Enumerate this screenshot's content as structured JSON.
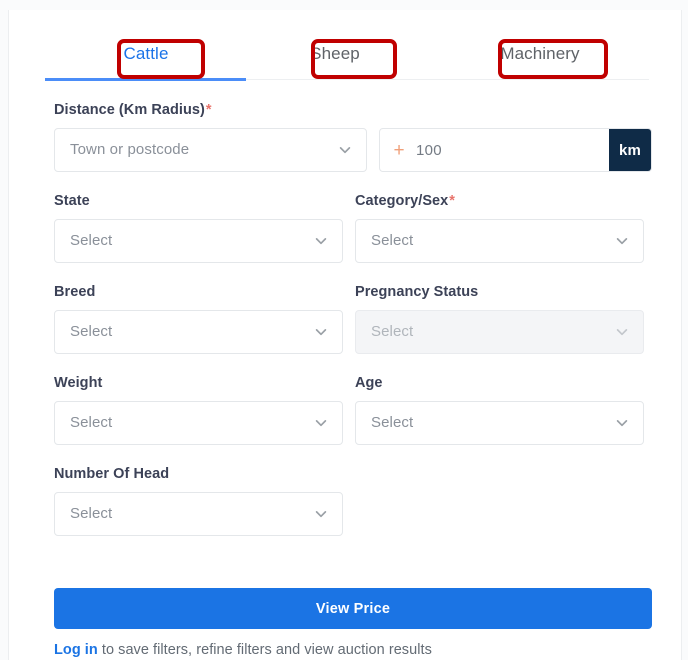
{
  "tabs": [
    {
      "label": "Cattle",
      "active": true
    },
    {
      "label": "Sheep",
      "active": false
    },
    {
      "label": "Machinery",
      "active": false
    }
  ],
  "form": {
    "distance": {
      "label": "Distance (Km Radius)",
      "required_marker": "*",
      "location_placeholder": "Town or postcode",
      "radius_plus": "+",
      "radius_value": "100",
      "unit": "km"
    },
    "state": {
      "label": "State",
      "placeholder": "Select"
    },
    "category_sex": {
      "label": "Category/Sex",
      "required_marker": "*",
      "placeholder": "Select"
    },
    "breed": {
      "label": "Breed",
      "placeholder": "Select"
    },
    "pregnancy_status": {
      "label": "Pregnancy Status",
      "placeholder": "Select",
      "disabled": true
    },
    "weight": {
      "label": "Weight",
      "placeholder": "Select"
    },
    "age": {
      "label": "Age",
      "placeholder": "Select"
    },
    "number_of_head": {
      "label": "Number Of Head",
      "placeholder": "Select"
    }
  },
  "actions": {
    "view_price_label": "View Price"
  },
  "footer": {
    "login_label": "Log in",
    "note_text": " to save filters, refine filters and view auction results"
  },
  "colors": {
    "accent_blue": "#1b74e4",
    "tab_active": "#1a73e8",
    "tab_underline": "#4b8df8",
    "annotation_red": "#c00000",
    "unit_badge": "#0f2b47",
    "required_red": "#e8736b"
  }
}
